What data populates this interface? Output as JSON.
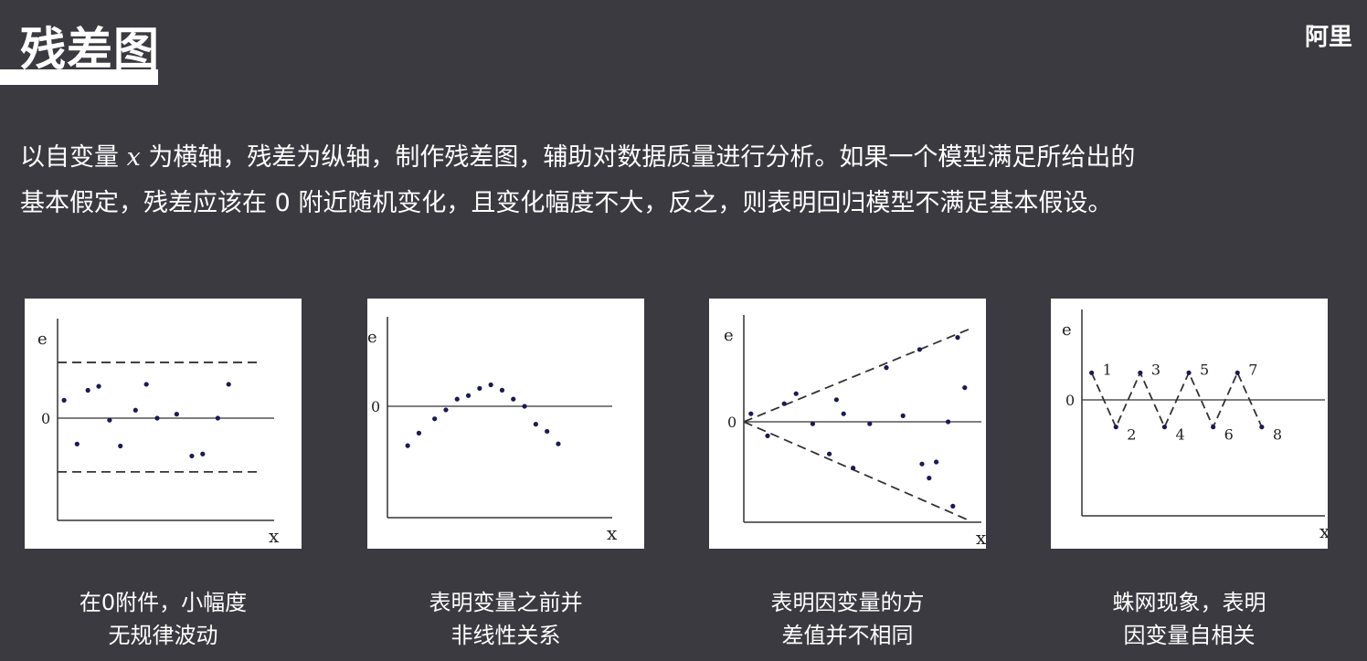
{
  "page": {
    "title": "残差图",
    "brand": "阿里",
    "intro": {
      "line1_part1": "以自变量 ",
      "var": "x",
      "line1_part2": " 为横轴，残差为纵轴，制作残差图，辅助对数据质量进行分析。如果一个模型满足所给出的",
      "line2": "基本假定，残差应该在 0 附近随机变化，且变化幅度不大，反之，则表明回归模型不满足基本假设。"
    }
  },
  "colors": {
    "background": "#3a3a40",
    "text": "#ffffff",
    "panel": "#ffffff",
    "axis": "#333333",
    "point": "#1a1a55"
  },
  "chart_data": [
    {
      "type": "scatter",
      "title": "",
      "caption": [
        "在0附件，小幅度",
        "无规律波动"
      ],
      "xlabel": "x",
      "ylabel": "e",
      "zero_label": "0",
      "xlim": [
        0,
        10
      ],
      "ylim": [
        -5,
        5
      ],
      "reference_lines": [
        {
          "y": 0,
          "style": "solid"
        },
        {
          "y": 2.8,
          "style": "dashed"
        },
        {
          "y": -2.7,
          "style": "dashed"
        }
      ],
      "points": [
        {
          "x": 0.3,
          "y": 0.9
        },
        {
          "x": 0.9,
          "y": -1.3
        },
        {
          "x": 1.4,
          "y": 1.4
        },
        {
          "x": 1.9,
          "y": 1.6
        },
        {
          "x": 2.4,
          "y": -0.1
        },
        {
          "x": 2.9,
          "y": -1.4
        },
        {
          "x": 3.6,
          "y": 0.4
        },
        {
          "x": 4.1,
          "y": 1.7
        },
        {
          "x": 4.6,
          "y": 0.0
        },
        {
          "x": 5.5,
          "y": 0.2
        },
        {
          "x": 6.2,
          "y": -1.9
        },
        {
          "x": 6.7,
          "y": -1.8
        },
        {
          "x": 7.4,
          "y": 0.0
        },
        {
          "x": 7.9,
          "y": 1.7
        }
      ]
    },
    {
      "type": "scatter",
      "title": "",
      "caption": [
        "表明变量之前并",
        "非线性关系"
      ],
      "xlabel": "x",
      "ylabel": "e",
      "zero_label": "0",
      "xlim": [
        0,
        10
      ],
      "ylim": [
        -5,
        5
      ],
      "reference_lines": [
        {
          "y": 0,
          "style": "solid"
        }
      ],
      "points": [
        {
          "x": 0.9,
          "y": -2.2
        },
        {
          "x": 1.4,
          "y": -1.5
        },
        {
          "x": 2.1,
          "y": -0.7
        },
        {
          "x": 2.6,
          "y": -0.2
        },
        {
          "x": 3.1,
          "y": 0.4
        },
        {
          "x": 3.6,
          "y": 0.6
        },
        {
          "x": 4.1,
          "y": 1.0
        },
        {
          "x": 4.6,
          "y": 1.2
        },
        {
          "x": 5.1,
          "y": 0.9
        },
        {
          "x": 5.6,
          "y": 0.4
        },
        {
          "x": 6.1,
          "y": 0.0
        },
        {
          "x": 6.6,
          "y": -1.0
        },
        {
          "x": 7.1,
          "y": -1.4
        },
        {
          "x": 7.6,
          "y": -2.1
        }
      ]
    },
    {
      "type": "scatter",
      "title": "",
      "caption": [
        "表明因变量的方",
        "差值并不相同"
      ],
      "xlabel": "x",
      "ylabel": "e",
      "zero_label": "0",
      "xlim": [
        0,
        10
      ],
      "ylim": [
        -5,
        5
      ],
      "reference_lines": [
        {
          "y": 0,
          "style": "solid"
        }
      ],
      "envelope": {
        "style": "dashed",
        "upper": [
          [
            0,
            0
          ],
          [
            10,
            4.6
          ]
        ],
        "lower": [
          [
            0,
            0
          ],
          [
            10,
            -4.9
          ]
        ]
      },
      "points": [
        {
          "x": 0.3,
          "y": 0.4
        },
        {
          "x": 1.0,
          "y": -0.7
        },
        {
          "x": 1.7,
          "y": 0.9
        },
        {
          "x": 2.2,
          "y": 1.4
        },
        {
          "x": 2.9,
          "y": -0.1
        },
        {
          "x": 3.6,
          "y": -1.6
        },
        {
          "x": 3.9,
          "y": 1.1
        },
        {
          "x": 4.2,
          "y": 0.4
        },
        {
          "x": 4.6,
          "y": -2.3
        },
        {
          "x": 5.3,
          "y": -0.1
        },
        {
          "x": 6.0,
          "y": 2.7
        },
        {
          "x": 6.7,
          "y": 0.3
        },
        {
          "x": 7.4,
          "y": 3.6
        },
        {
          "x": 7.5,
          "y": -2.1
        },
        {
          "x": 7.8,
          "y": -2.8
        },
        {
          "x": 8.1,
          "y": -2.0
        },
        {
          "x": 8.6,
          "y": 0.0
        },
        {
          "x": 8.8,
          "y": -4.2
        },
        {
          "x": 9.0,
          "y": 4.2
        },
        {
          "x": 9.3,
          "y": 1.7
        }
      ]
    },
    {
      "type": "line",
      "title": "",
      "caption": [
        "蛛网现象，表明",
        "因变量自相关"
      ],
      "xlabel": "x",
      "ylabel": "e",
      "zero_label": "0",
      "xlim": [
        0,
        10
      ],
      "ylim": [
        -5,
        5
      ],
      "reference_lines": [
        {
          "y": 0,
          "style": "solid"
        }
      ],
      "line_style": "dashed",
      "points": [
        {
          "x": 0.4,
          "y": 1.5,
          "label": "1"
        },
        {
          "x": 1.4,
          "y": -1.5,
          "label": "2"
        },
        {
          "x": 2.4,
          "y": 1.5,
          "label": "3"
        },
        {
          "x": 3.4,
          "y": -1.5,
          "label": "4"
        },
        {
          "x": 4.4,
          "y": 1.5,
          "label": "5"
        },
        {
          "x": 5.4,
          "y": -1.5,
          "label": "6"
        },
        {
          "x": 6.4,
          "y": 1.5,
          "label": "7"
        },
        {
          "x": 7.4,
          "y": -1.5,
          "label": "8"
        }
      ]
    }
  ]
}
